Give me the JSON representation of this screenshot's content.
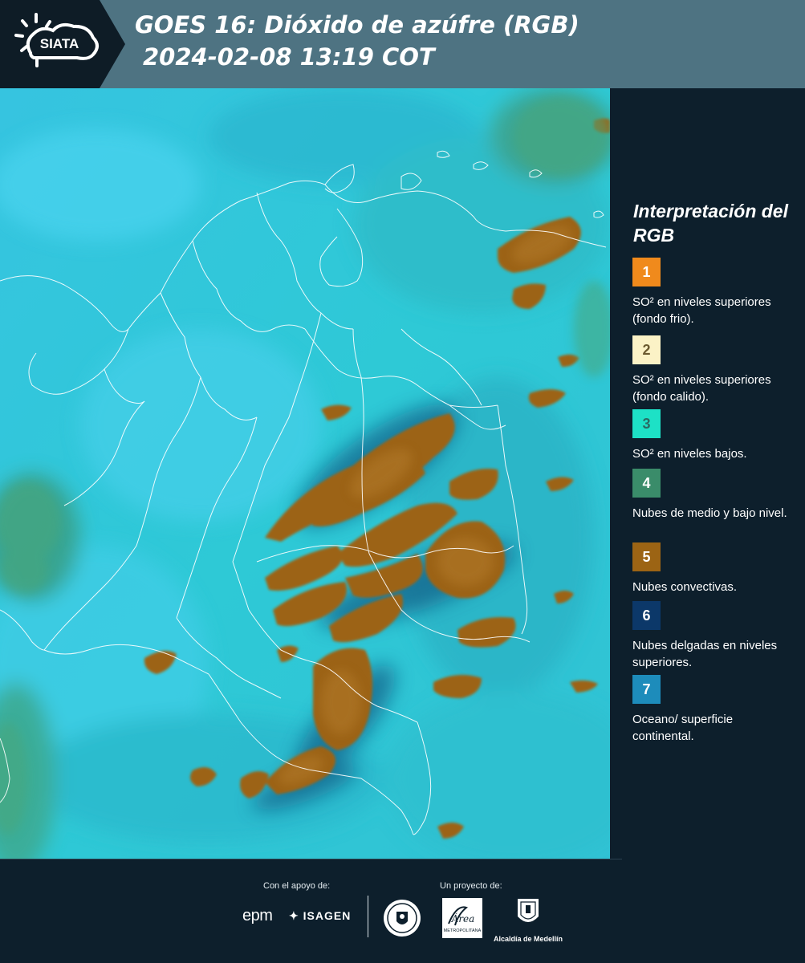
{
  "header": {
    "logo_text": "SIATA",
    "title_line1": "GOES 16: Dióxido de azúfre (RGB)",
    "title_line2": "2024-02-08 13:19 COT",
    "background_color": "#4e7382"
  },
  "legend": {
    "title": "Interpretación del RGB",
    "items": [
      {
        "number": "1",
        "color": "#f08a1c",
        "text": "SO² en niveles superiores (fondo frio)."
      },
      {
        "number": "2",
        "color": "#fbf2c6",
        "text": "SO² en niveles superiores (fondo calido)."
      },
      {
        "number": "3",
        "color": "#1de1c6",
        "text": "SO² en niveles bajos."
      },
      {
        "number": "4",
        "color": "#3a8c6a",
        "text": "Nubes de medio y bajo nivel."
      },
      {
        "number": "5",
        "color": "#9c6414",
        "text": "Nubes convectivas."
      },
      {
        "number": "6",
        "color": "#0c3869",
        "text": "Nubes delgadas en niveles superiores."
      },
      {
        "number": "7",
        "color": "#1d8cbb",
        "text": "Oceano/ superficie continental."
      }
    ]
  },
  "footer": {
    "support_label": "Con el apoyo de:",
    "project_label": "Un proyecto de:",
    "sponsor_epm": "epm",
    "sponsor_isagen": "ISAGEN",
    "area_logo_text": "Área",
    "area_logo_subtext": "METROPOLITANA",
    "alcaldia_text": "Alcaldía de Medellín"
  },
  "colors": {
    "panel_background": "#0d1f2c",
    "map_background": "#2fc6dc",
    "convective_cloud": "#9c6414"
  },
  "icons": [
    "sun-icon",
    "cloud-icon",
    "seal-icon",
    "alcaldia-shield-icon"
  ]
}
